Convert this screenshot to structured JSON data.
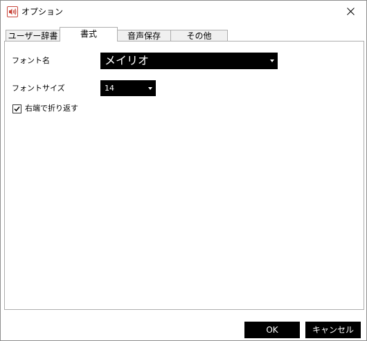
{
  "window": {
    "title": "オプション",
    "app_icon": "speaker-icon",
    "close_icon": "close-icon"
  },
  "tabs": [
    {
      "label": "ユーザー辞書",
      "active": false
    },
    {
      "label": "書式",
      "active": true
    },
    {
      "label": "音声保存",
      "active": false
    },
    {
      "label": "その他",
      "active": false
    }
  ],
  "format": {
    "font_name_label": "フォント名",
    "font_name_value": "メイリオ",
    "font_size_label": "フォントサイズ",
    "font_size_value": "14",
    "wrap_label": "右端で折り返す",
    "wrap_checked": true
  },
  "buttons": {
    "ok": "OK",
    "cancel": "キャンセル"
  },
  "colors": {
    "icon_red": "#c8443a",
    "combo_bg": "#000000",
    "button_bg": "#000000"
  }
}
